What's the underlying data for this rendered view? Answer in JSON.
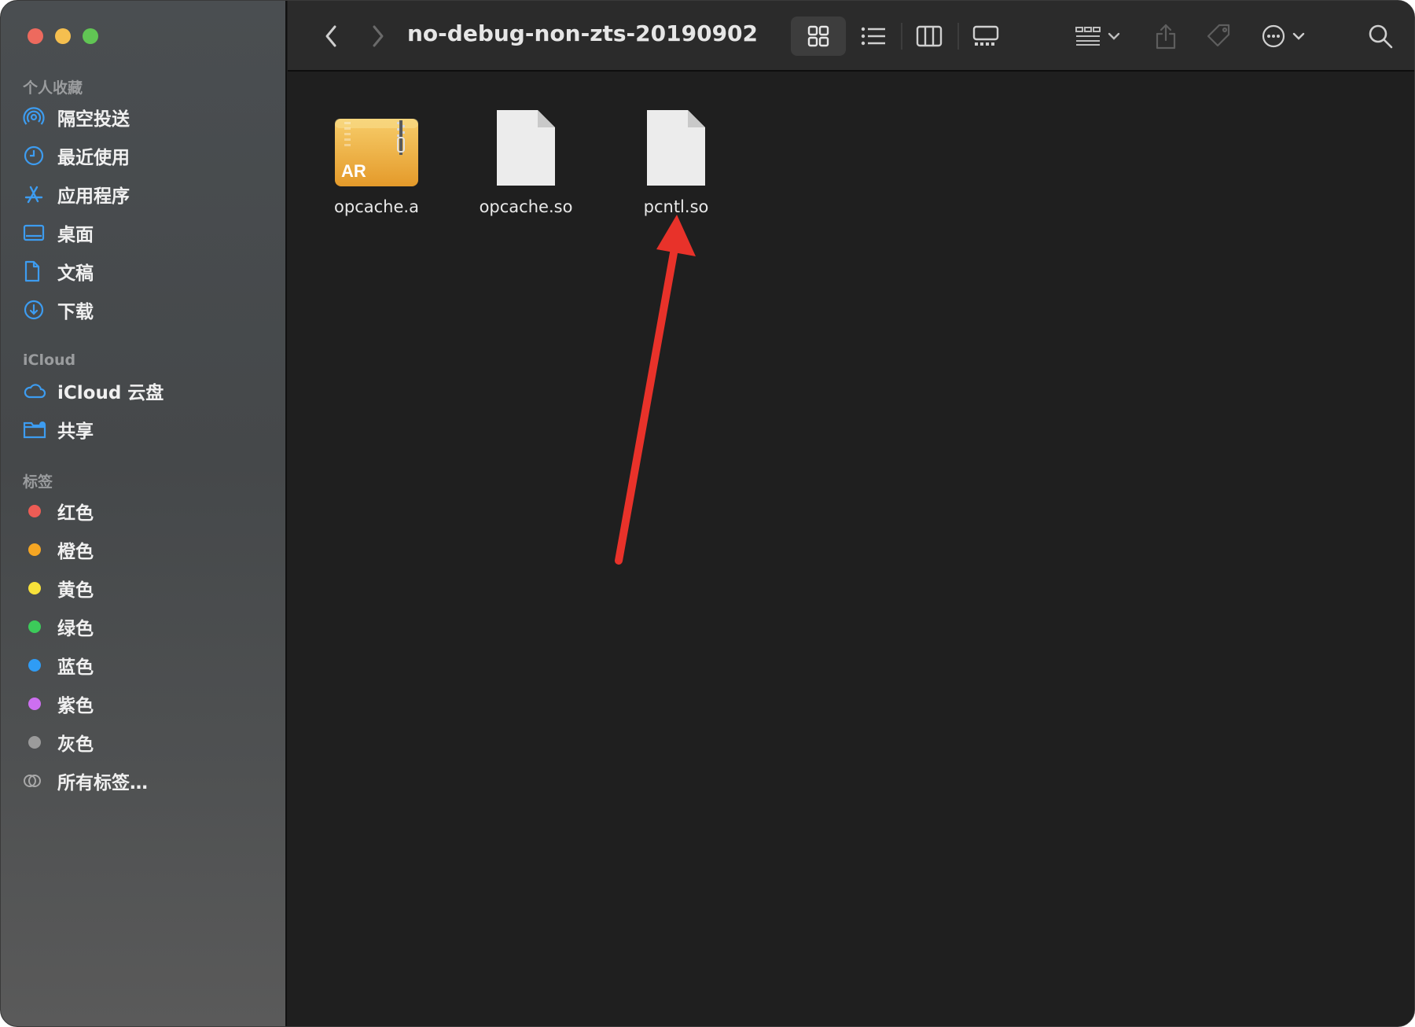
{
  "window": {
    "path_title": "no-debug-non-zts-20190902"
  },
  "sidebar": {
    "favorites_title": "个人收藏",
    "favorites": [
      {
        "label": "隔空投送",
        "icon": "airdrop-icon"
      },
      {
        "label": "最近使用",
        "icon": "clock-icon"
      },
      {
        "label": "应用程序",
        "icon": "applications-icon"
      },
      {
        "label": "桌面",
        "icon": "desktop-icon"
      },
      {
        "label": "文稿",
        "icon": "document-icon"
      },
      {
        "label": "下载",
        "icon": "download-icon"
      }
    ],
    "icloud_title": "iCloud",
    "icloud": [
      {
        "label": "iCloud 云盘",
        "icon": "cloud-icon"
      },
      {
        "label": "共享",
        "icon": "shared-folder-icon"
      }
    ],
    "tags_title": "标签",
    "tags": [
      {
        "label": "红色",
        "color": "#ed5c55"
      },
      {
        "label": "橙色",
        "color": "#f5a623"
      },
      {
        "label": "黄色",
        "color": "#f7e13a"
      },
      {
        "label": "绿色",
        "color": "#3ccb5a"
      },
      {
        "label": "蓝色",
        "color": "#2f9cf5"
      },
      {
        "label": "紫色",
        "color": "#cd6ff0"
      },
      {
        "label": "灰色",
        "color": "#9b9b9b"
      }
    ],
    "all_tags_label": "所有标签…"
  },
  "toolbar": {
    "back_icon": "chevron-left-icon",
    "forward_icon": "chevron-right-icon",
    "views": [
      "icon-view-icon",
      "list-view-icon",
      "column-view-icon",
      "gallery-view-icon"
    ],
    "active_view": "icon-view-icon"
  },
  "files": [
    {
      "name": "opcache.a",
      "kind": "archive",
      "badge": "AR"
    },
    {
      "name": "opcache.so",
      "kind": "document"
    },
    {
      "name": "pcntl.so",
      "kind": "document"
    }
  ],
  "annotation": {
    "color": "#e8322a",
    "points_to": "pcntl.so"
  }
}
